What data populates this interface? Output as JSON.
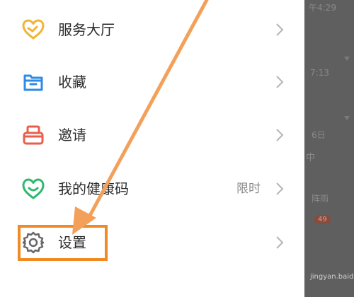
{
  "menu": {
    "items": [
      {
        "label": "服务大厅",
        "icon": "heart-hands-icon",
        "trail": ""
      },
      {
        "label": "收藏",
        "icon": "folder-box-icon",
        "trail": ""
      },
      {
        "label": "邀请",
        "icon": "invite-box-icon",
        "trail": ""
      },
      {
        "label": "我的健康码",
        "icon": "smile-heart-icon",
        "trail": "限时"
      },
      {
        "label": "设置",
        "icon": "gear-icon",
        "trail": ""
      }
    ]
  },
  "background": {
    "fragments": [
      "午4:29",
      "7:13",
      "6日",
      "中",
      "阵雨"
    ],
    "badge": "49",
    "watermark": "jingyan.baidu.com"
  },
  "colors": {
    "accent_orange": "#f08a24",
    "icon_yellow": "#f2b435",
    "icon_blue": "#2f8be6",
    "icon_red": "#e8604c",
    "icon_green": "#2fb86e",
    "icon_gray": "#666666"
  }
}
